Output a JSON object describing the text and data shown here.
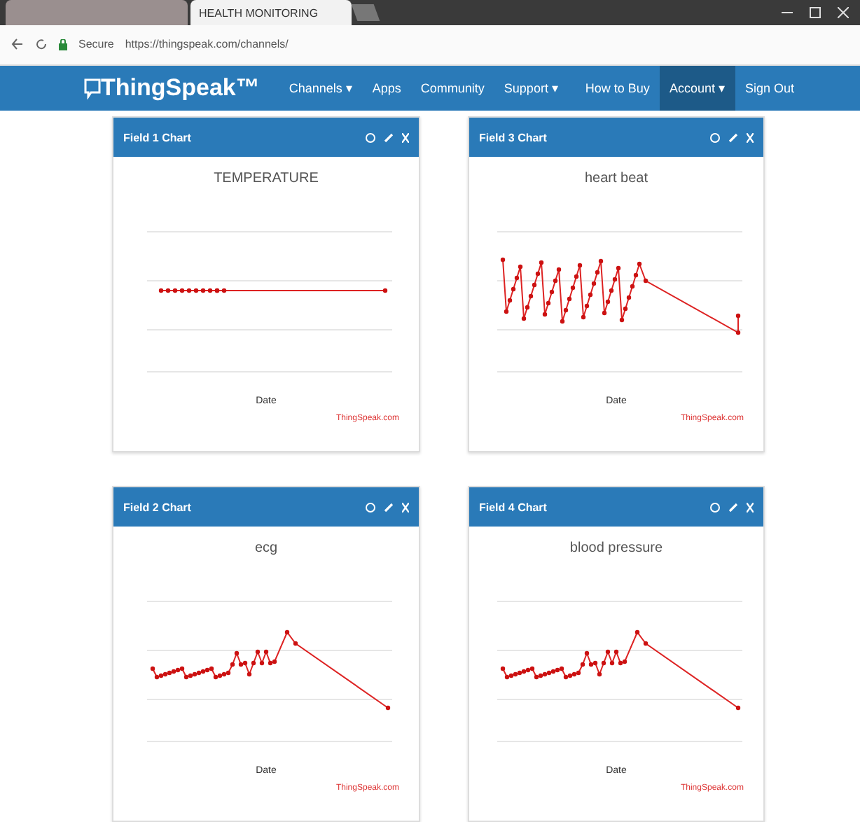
{
  "browser": {
    "tabs": [
      {
        "selected": false
      },
      {
        "title": "HEALTH MONITORING",
        "selected": true
      }
    ],
    "url_secure": "Secure",
    "url": "https://thingspeak.com/channels/"
  },
  "navbar": {
    "brand": "ThingSpeak™",
    "left": [
      {
        "label": "Channels ▾",
        "selected": false
      },
      {
        "label": "Apps",
        "selected": false
      },
      {
        "label": "Community",
        "selected": false
      },
      {
        "label": "Support ▾",
        "selected": false
      }
    ],
    "right": [
      {
        "label": "How to Buy",
        "selected": false
      },
      {
        "label": "Account ▾",
        "selected": true
      },
      {
        "label": "Sign Out",
        "selected": false
      }
    ]
  },
  "charts": [
    {
      "header": "Field 1 Chart",
      "title": "TEMPERATURE",
      "xlabel": "Date",
      "credit": "ThingSpeak.com",
      "kind": "flat"
    },
    {
      "header": "Field 3 Chart",
      "title": "heart beat",
      "xlabel": "Date",
      "credit": "ThingSpeak.com",
      "kind": "noisy"
    },
    {
      "header": "Field 2 Chart",
      "title": "ecg",
      "xlabel": "Date",
      "credit": "ThingSpeak.com",
      "kind": "step"
    },
    {
      "header": "Field 4 Chart",
      "title": "blood pressure",
      "xlabel": "Date",
      "credit": "ThingSpeak.com",
      "kind": "step"
    }
  ]
}
